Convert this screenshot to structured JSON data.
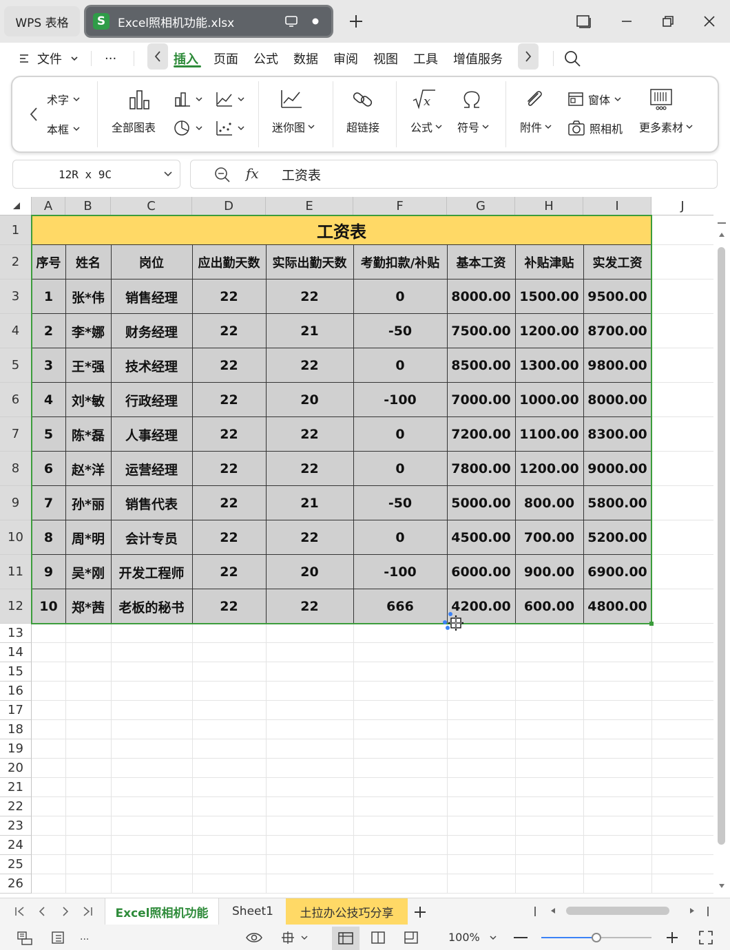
{
  "titlebar": {
    "home_tab": "WPS 表格",
    "doc_tab": "Excel照相机功能.xlsx",
    "doc_logo": "S"
  },
  "menubar": {
    "file": "文件",
    "more": "···",
    "items": [
      "插入",
      "页面",
      "公式",
      "数据",
      "审阅",
      "视图",
      "工具",
      "增值服务"
    ]
  },
  "ribbon": {
    "wordart": "术字",
    "textbox": "本框",
    "all_charts": "全部图表",
    "sparkline": "迷你图",
    "hyperlink": "超链接",
    "formula": "公式",
    "symbol": "符号",
    "attachment": "附件",
    "form": "窗体",
    "camera": "照相机",
    "more_assets": "更多素材"
  },
  "formula_bar": {
    "name_box": "12R x 9C",
    "fx": "fx",
    "content": "工资表"
  },
  "columns": [
    "A",
    "B",
    "C",
    "D",
    "E",
    "F",
    "G",
    "H",
    "I",
    "J"
  ],
  "rows": [
    "1",
    "2",
    "3",
    "4",
    "5",
    "6",
    "7",
    "8",
    "9",
    "10",
    "11",
    "12",
    "13",
    "14",
    "15",
    "16",
    "17",
    "18",
    "19",
    "20",
    "21",
    "22",
    "23",
    "24",
    "25",
    "26"
  ],
  "table": {
    "title": "工资表",
    "headers": [
      "序号",
      "姓名",
      "岗位",
      "应出勤天数",
      "实际出勤天数",
      "考勤扣款/补贴",
      "基本工资",
      "补贴津贴",
      "实发工资"
    ],
    "rows": [
      [
        "1",
        "张*伟",
        "销售经理",
        "22",
        "22",
        "0",
        "8000.00",
        "1500.00",
        "9500.00"
      ],
      [
        "2",
        "李*娜",
        "财务经理",
        "22",
        "21",
        "-50",
        "7500.00",
        "1200.00",
        "8700.00"
      ],
      [
        "3",
        "王*强",
        "技术经理",
        "22",
        "22",
        "0",
        "8500.00",
        "1300.00",
        "9800.00"
      ],
      [
        "4",
        "刘*敏",
        "行政经理",
        "22",
        "20",
        "-100",
        "7000.00",
        "1000.00",
        "8000.00"
      ],
      [
        "5",
        "陈*磊",
        "人事经理",
        "22",
        "22",
        "0",
        "7200.00",
        "1100.00",
        "8300.00"
      ],
      [
        "6",
        "赵*洋",
        "运营经理",
        "22",
        "22",
        "0",
        "7800.00",
        "1200.00",
        "9000.00"
      ],
      [
        "7",
        "孙*丽",
        "销售代表",
        "22",
        "21",
        "-50",
        "5000.00",
        "800.00",
        "5800.00"
      ],
      [
        "8",
        "周*明",
        "会计专员",
        "22",
        "22",
        "0",
        "4500.00",
        "700.00",
        "5200.00"
      ],
      [
        "9",
        "吴*刚",
        "开发工程师",
        "22",
        "20",
        "-100",
        "6000.00",
        "900.00",
        "6900.00"
      ],
      [
        "10",
        "郑*茜",
        "老板的秘书",
        "22",
        "22",
        "666",
        "4200.00",
        "600.00",
        "4800.00"
      ]
    ]
  },
  "sheets": {
    "active": "Excel照相机功能",
    "sheet1": "Sheet1",
    "promo": "土拉办公技巧分享"
  },
  "status": {
    "zoom": "100%",
    "ellipsis": "..."
  },
  "colors": {
    "title_fill": "#ffd966",
    "cell_fill": "#d0d0d0",
    "selection_border": "#3b9c3b",
    "accent": "#2e8b3a"
  }
}
